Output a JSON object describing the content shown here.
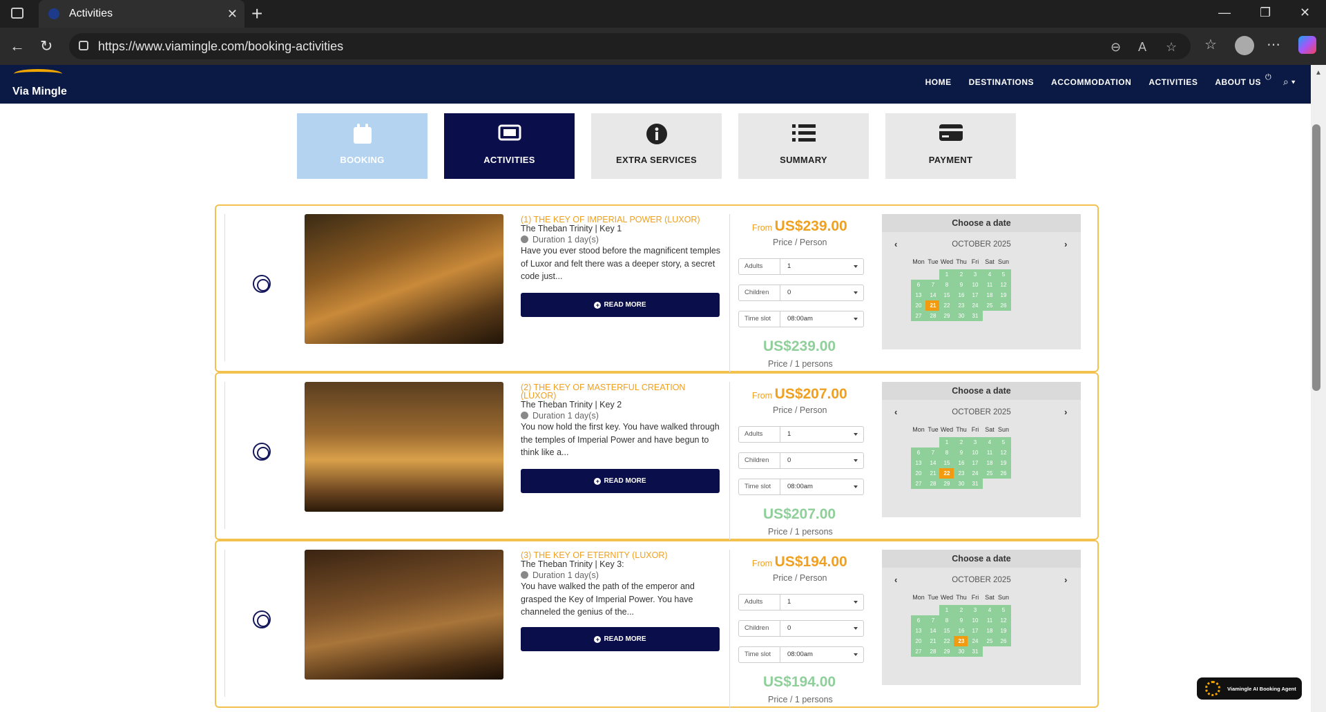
{
  "browser": {
    "tab_title": "Activities",
    "url": "https://www.viamingle.com/booking-activities"
  },
  "site": {
    "logo_text": "Via Mingle",
    "menu": [
      "HOME",
      "DESTINATIONS",
      "ACCOMMODATION",
      "ACTIVITIES",
      "ABOUT US"
    ]
  },
  "steps": [
    {
      "label": "BOOKING",
      "icon": "calendar-icon",
      "state": "done"
    },
    {
      "label": "ACTIVITIES",
      "icon": "ticket-icon",
      "state": "active"
    },
    {
      "label": "EXTRA SERVICES",
      "icon": "info-icon",
      "state": "pending"
    },
    {
      "label": "SUMMARY",
      "icon": "list-icon",
      "state": "pending"
    },
    {
      "label": "PAYMENT",
      "icon": "credit-card-icon",
      "state": "pending"
    }
  ],
  "activities": [
    {
      "title": "(1) THE KEY OF IMPERIAL POWER (LUXOR)",
      "subtitle": "The Theban Trinity | Key 1",
      "duration": "Duration 1 day(s)",
      "description": "Have you ever stood before the magnificent temples of Luxor and felt there was a deeper story, a secret code just...",
      "read_more": "READ MORE",
      "from_label": "From",
      "price": "US$239.00",
      "price_per": "Price / Person",
      "adults_label": "Adults",
      "adults_value": "1",
      "children_label": "Children",
      "children_value": "0",
      "timeslot_label": "Time slot",
      "timeslot_value": "08:00am",
      "total": "US$239.00",
      "total_label": "Price / 1 persons",
      "calendar_title": "Choose a date",
      "calendar_month": "OCTOBER 2025",
      "selected_day": 21
    },
    {
      "title": "(2) THE KEY OF MASTERFUL CREATION (LUXOR)",
      "subtitle": "The Theban Trinity | Key 2",
      "duration": "Duration 1 day(s)",
      "description": "You now hold the first key. You have walked through the temples of Imperial Power and have begun to think like a...",
      "read_more": "READ MORE",
      "from_label": "From",
      "price": "US$207.00",
      "price_per": "Price / Person",
      "adults_label": "Adults",
      "adults_value": "1",
      "children_label": "Children",
      "children_value": "0",
      "timeslot_label": "Time slot",
      "timeslot_value": "08:00am",
      "total": "US$207.00",
      "total_label": "Price / 1 persons",
      "calendar_title": "Choose a date",
      "calendar_month": "OCTOBER 2025",
      "selected_day": 22
    },
    {
      "title": "(3) THE KEY OF ETERNITY (LUXOR)",
      "subtitle": "The Theban Trinity | Key 3:",
      "duration": "Duration 1 day(s)",
      "description": "You have walked the path of the emperor and grasped the Key of Imperial Power. You have channeled the genius of the...",
      "read_more": "READ MORE",
      "from_label": "From",
      "price": "US$194.00",
      "price_per": "Price / Person",
      "adults_label": "Adults",
      "adults_value": "1",
      "children_label": "Children",
      "children_value": "0",
      "timeslot_label": "Time slot",
      "timeslot_value": "08:00am",
      "total": "US$194.00",
      "total_label": "Price / 1 persons",
      "calendar_title": "Choose a date",
      "calendar_month": "OCTOBER 2025",
      "selected_day": 23
    }
  ],
  "weekdays": [
    "Mon",
    "Tue",
    "Wed",
    "Thu",
    "Fri",
    "Sat",
    "Sun"
  ],
  "agent_label": "Viamingle AI Booking Agent",
  "colors": {
    "navy": "#0b1a45",
    "accent": "#f0a020",
    "green": "#8fcf9a",
    "selected": "#f29a10"
  }
}
